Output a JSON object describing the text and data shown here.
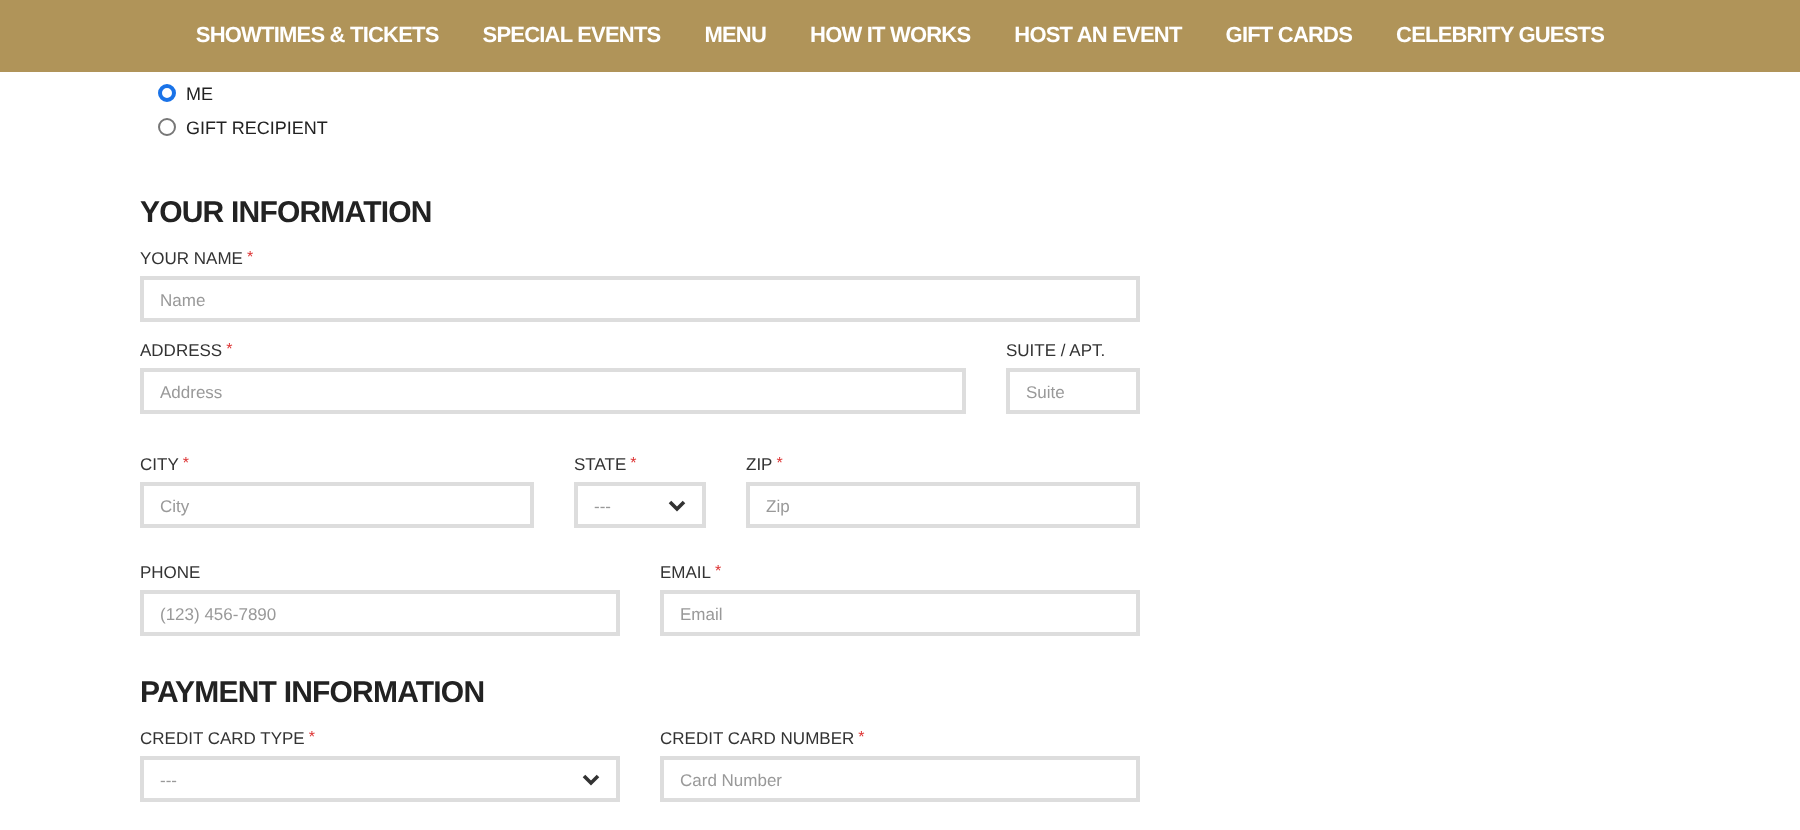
{
  "nav": {
    "items": [
      "SHOWTIMES & TICKETS",
      "SPECIAL EVENTS",
      "MENU",
      "HOW IT WORKS",
      "HOST AN EVENT",
      "GIFT CARDS",
      "CELEBRITY GUESTS"
    ]
  },
  "recipient": [
    {
      "label": "ME",
      "selected": true
    },
    {
      "label": "GIFT RECIPIENT",
      "selected": false
    }
  ],
  "sections": [
    {
      "title": "YOUR INFORMATION",
      "rows": [
        {
          "fields": [
            {
              "kind": "text",
              "label": "YOUR NAME",
              "required_mark": "*",
              "placeholder": "Name"
            }
          ]
        },
        {
          "fields": [
            {
              "kind": "text",
              "label": "ADDRESS",
              "required_mark": "*",
              "placeholder": "Address"
            },
            {
              "kind": "text",
              "label": "SUITE / APT.",
              "placeholder": "Suite"
            }
          ]
        },
        {
          "fields": [
            {
              "kind": "text",
              "label": "CITY",
              "required_mark": "*",
              "placeholder": "City"
            },
            {
              "kind": "select",
              "label": "STATE",
              "required_mark": "*",
              "placeholder": "---"
            },
            {
              "kind": "text",
              "label": "ZIP",
              "required_mark": "*",
              "placeholder": "Zip"
            }
          ]
        },
        {
          "fields": [
            {
              "kind": "text",
              "label": "PHONE",
              "placeholder": "(123) 456-7890"
            },
            {
              "kind": "text",
              "label": "EMAIL",
              "required_mark": "*",
              "placeholder": "Email"
            }
          ]
        }
      ]
    },
    {
      "title": "PAYMENT INFORMATION",
      "rows": [
        {
          "fields": [
            {
              "kind": "select",
              "label": "CREDIT CARD TYPE",
              "required_mark": "*",
              "placeholder": "---"
            },
            {
              "kind": "text",
              "label": "CREDIT CARD NUMBER",
              "required_mark": "*",
              "placeholder": "Card Number"
            }
          ]
        }
      ]
    }
  ]
}
